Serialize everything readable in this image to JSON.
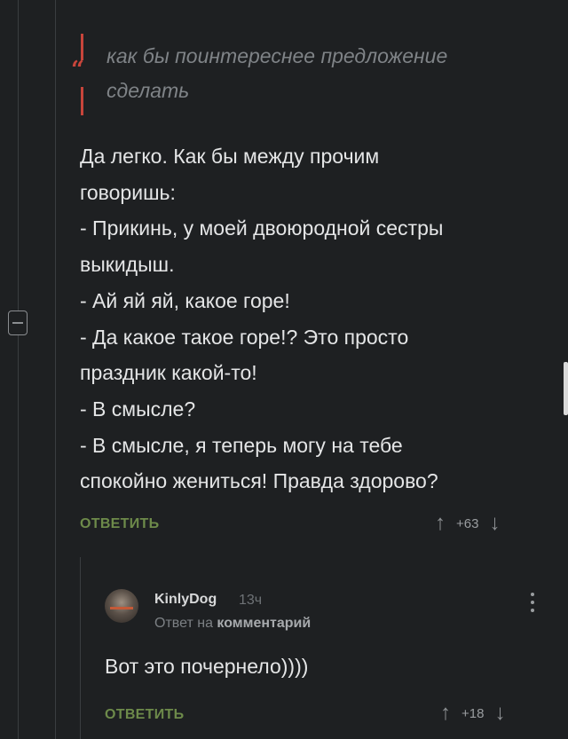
{
  "quote": {
    "lines": [
      "как бы поинтереснее предложение",
      "сделать"
    ]
  },
  "comment": {
    "lines": [
      "Да легко. Как бы между прочим",
      "говоришь:",
      "- Прикинь, у моей двоюродной сестры",
      "выкидыш.",
      "- Ай яй яй, какое горе!",
      "- Да какое такое горе!? Это просто",
      "праздник какой-то!",
      "- В смысле?",
      "- В смысле, я теперь могу на тебе",
      "спокойно жениться! Правда здорово?"
    ],
    "reply_label": "ОТВЕТИТЬ",
    "score": "+63"
  },
  "reply": {
    "username": "KinlyDog",
    "time": "13ч",
    "reply_prefix": "Ответ на",
    "reply_target": "комментарий",
    "text": "Вот это почернело))))",
    "reply_label": "ОТВЕТИТЬ",
    "score": "+18"
  },
  "icons": {
    "upvote": "↑",
    "downvote": "↓",
    "quote_mark": "“"
  },
  "colors": {
    "background": "#1e2022",
    "quote_accent": "#c8453b",
    "reply_link": "#6d8a4a"
  }
}
